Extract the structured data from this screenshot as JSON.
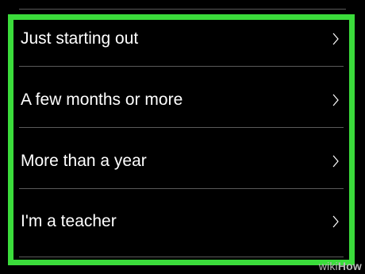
{
  "options": [
    {
      "label": "Just starting out",
      "icon": "chevron-right-icon"
    },
    {
      "label": "A few months or more",
      "icon": "chevron-right-icon"
    },
    {
      "label": "More than a year",
      "icon": "chevron-right-icon"
    },
    {
      "label": "I'm a teacher",
      "icon": "chevron-right-icon"
    }
  ],
  "watermark": {
    "part1": "wiki",
    "part2": "How"
  },
  "colors": {
    "highlight": "#3bdc3b",
    "background": "#000000",
    "text": "#ffffff",
    "divider": "#5a5a5a"
  }
}
